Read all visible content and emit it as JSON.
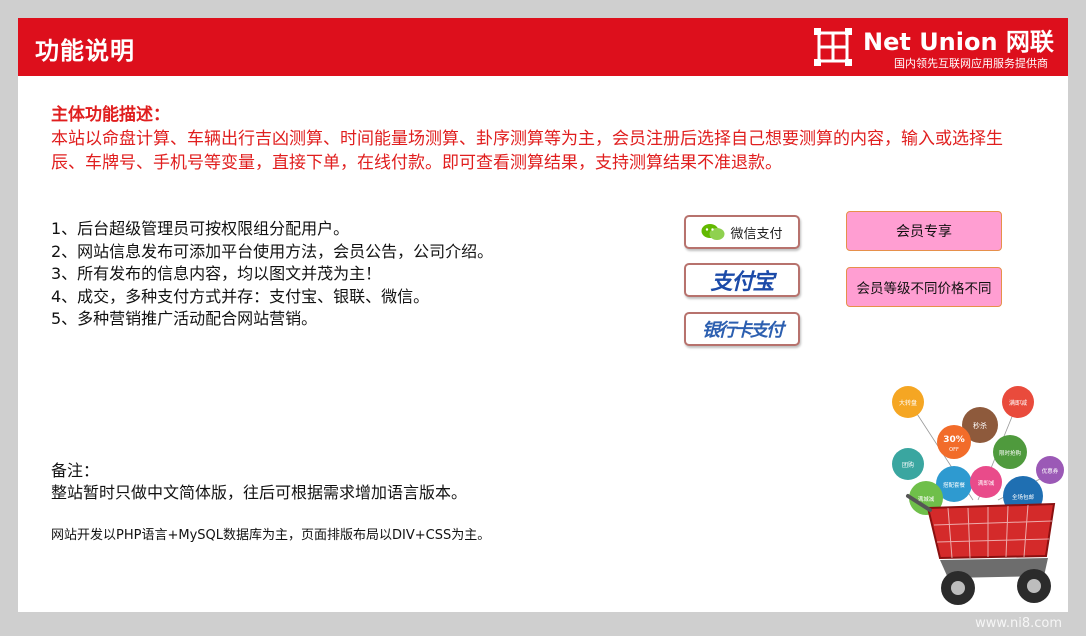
{
  "header": {
    "title": "功能说明",
    "logo_name": "Net Union 网联",
    "logo_tagline": "国内领先互联网应用服务提供商"
  },
  "description": {
    "heading": "主体功能描述：",
    "body": "本站以命盘计算、车辆出行吉凶测算、时间能量场测算、卦序测算等为主，会员注册后选择自己想要测算的内容，输入或选择生辰、车牌号、手机号等变量，直接下单，在线付款。即可查看测算结果，支持测算结果不准退款。"
  },
  "features": [
    "1、后台超级管理员可按权限组分配用户。",
    "2、网站信息发布可添加平台使用方法，会员公告，公司介绍。",
    "3、所有发布的信息内容，均以图文并茂为主！",
    "4、成交，多种支付方式并存：支付宝、银联、微信。",
    "5、多种营销推广活动配合网站营销。"
  ],
  "payments": {
    "wechat_label": "微信支付",
    "alipay_label": "支付宝",
    "unionpay_label": "银行卡支付"
  },
  "member_badges": {
    "exclusive": "会员专享",
    "levels": "会员等级不同价格不同"
  },
  "notes": {
    "label": "备注：",
    "text": "整站暂时只做中文简体版，往后可根据需求增加语言版本。"
  },
  "tech_note": "网站开发以PHP语言+MySQL数据库为主，页面排版布局以DIV+CSS为主。",
  "cart_bubbles": {
    "b1": "大转盘",
    "b2": "满即减",
    "b3": "秒杀",
    "b4": "30%",
    "b4_sub": "OFF",
    "b5": "团购",
    "b6": "限时抢购",
    "b7": "优惠券",
    "b8": "搭配套餐",
    "b9": "满即减",
    "b10": "满城减",
    "b11": "全场包邮"
  },
  "watermark": "www.ni8.com",
  "colors": {
    "header_red": "#dd0f1c",
    "accent_text_red": "#e01e1e",
    "badge_pink": "#ff9ed2",
    "badge_border": "#e6904b",
    "alipay_blue": "#1b4aa8",
    "wechat_green": "#62b900"
  }
}
